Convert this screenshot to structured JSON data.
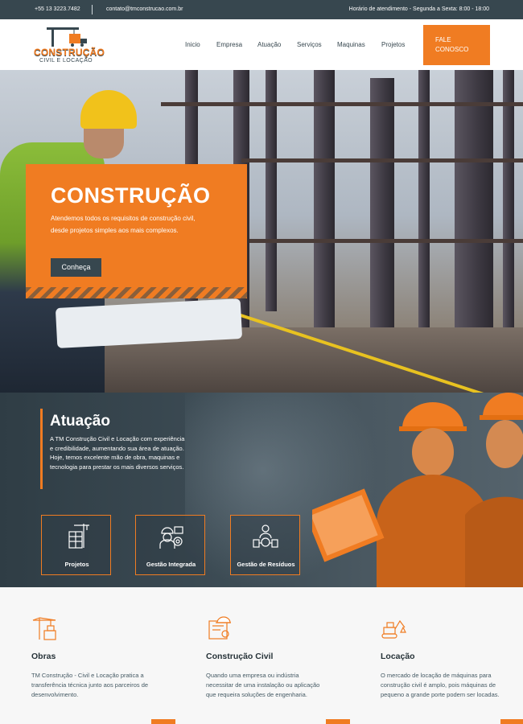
{
  "topbar": {
    "phone": "+55 13 3223.7482",
    "email": "contato@tmconstrucao.com.br",
    "hours": "Horário de atendimento - Segunda a Sexta: 8:00 - 18:00"
  },
  "logo": {
    "brand": "CONSTRUÇÃO",
    "sub": "CIVIL E LOCAÇÃO"
  },
  "nav": {
    "items": [
      "Inicio",
      "Empresa",
      "Atuação",
      "Serviços",
      "Maquinas",
      "Projetos"
    ],
    "cta_line1": "FALE",
    "cta_line2": "CONOSCO"
  },
  "hero": {
    "title": "CONSTRUÇÃO",
    "description": "Atendemos todos os requisitos de construção civil, desde projetos simples aos mais complexos.",
    "button": "Conheça"
  },
  "atuacao": {
    "title": "Atuação",
    "description": "A TM Construção Civil e Locação com experiência e credibilidade, aumentando sua área de atuação. Hoje, temos excelente mão de obra, maquinas e tecnologia para prestar os mais diversos serviços.",
    "cards": [
      {
        "label": "Projetos",
        "icon": "crane-building-icon"
      },
      {
        "label": "Gestão Integrada",
        "icon": "engineer-gear-icon"
      },
      {
        "label": "Gestão de Resíduos",
        "icon": "waste-management-icon"
      }
    ]
  },
  "services": [
    {
      "title": "Obras",
      "text": "TM Construção - Civil e Locação pratica a transferência técnica junto aos parceiros de desenvolvimento.",
      "icon": "tower-crane-icon"
    },
    {
      "title": "Construção Civil",
      "text": "Quando uma empresa ou indústria necessitar de uma instalação ou aplicação que requeira soluções de engenharia.",
      "icon": "blueprint-helmet-icon"
    },
    {
      "title": "Locação",
      "text": "O mercado de locação de máquinas para construção civil é amplo, pois máquinas de pequeno a grande porte podem ser locadas.",
      "icon": "excavator-icon"
    }
  ],
  "colors": {
    "accent": "#f07c22",
    "dark": "#37474f"
  }
}
